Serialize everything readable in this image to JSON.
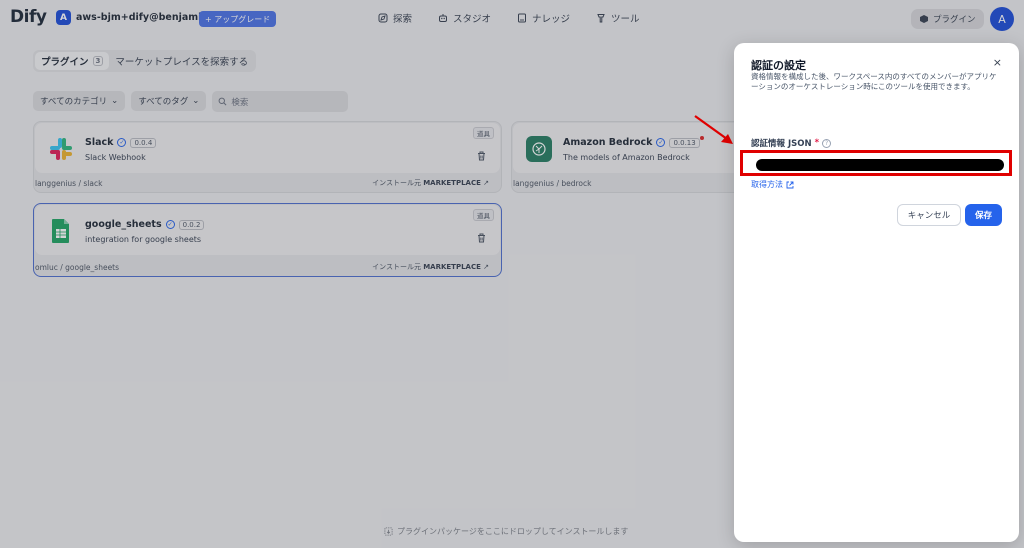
{
  "header": {
    "logo_text": "Dify",
    "workspace_initial": "A",
    "workspace_name": "aws-bjm+dify@benjami...",
    "upgrade_label": "+ アップグレード",
    "nav": [
      {
        "label": "探索",
        "icon": "explore-icon"
      },
      {
        "label": "スタジオ",
        "icon": "robot-icon"
      },
      {
        "label": "ナレッジ",
        "icon": "book-icon"
      },
      {
        "label": "ツール",
        "icon": "tool-icon"
      }
    ],
    "plugin_button_label": "プラグイン",
    "user_initial": "A"
  },
  "tabs": {
    "plugins_label": "プラグイン",
    "plugins_count": "3",
    "marketplace_label": "マーケットプレイスを探索する"
  },
  "filters": {
    "category_label": "すべてのカテゴリ",
    "tag_label": "すべてのタグ",
    "search_placeholder": "検索"
  },
  "cards": [
    {
      "name": "Slack",
      "version": "0.0.4",
      "desc": "Slack Webhook",
      "badge": "道具",
      "org_path": "langgenius / slack",
      "install_prefix": "インストール元",
      "install_source": "MARKETPLACE",
      "icon": "slack-icon"
    },
    {
      "name": "Amazon Bedrock",
      "version": "0.0.13",
      "desc": "The models of Amazon Bedrock",
      "badge": "",
      "org_path": "langgenius / bedrock",
      "install_prefix": "インストール元",
      "install_source": "MARKETPLACE",
      "icon": "bedrock-icon"
    },
    {
      "name": "google_sheets",
      "version": "0.0.2",
      "desc": "integration for google sheets",
      "badge": "道具",
      "org_path": "omluc / google_sheets",
      "install_prefix": "インストール元",
      "install_source": "MARKETPLACE",
      "icon": "google-sheets-icon"
    }
  ],
  "drop_hint": "プラグインパッケージをここにドロップしてインストールします",
  "modal": {
    "title": "認証の設定",
    "close": "×",
    "description": "資格情報を構成した後、ワークスペース内のすべてのメンバーがアプリケーションのオーケストレーション時にこのツールを使用できます。",
    "field_label": "認証情報 JSON",
    "required_mark": "*",
    "help_mark": "?",
    "link_label": "取得方法",
    "cancel_label": "キャンセル",
    "save_label": "保存"
  },
  "colors": {
    "accent": "#2563eb",
    "highlight_box": "#e00000",
    "annotation_arrow": "#e00000"
  }
}
